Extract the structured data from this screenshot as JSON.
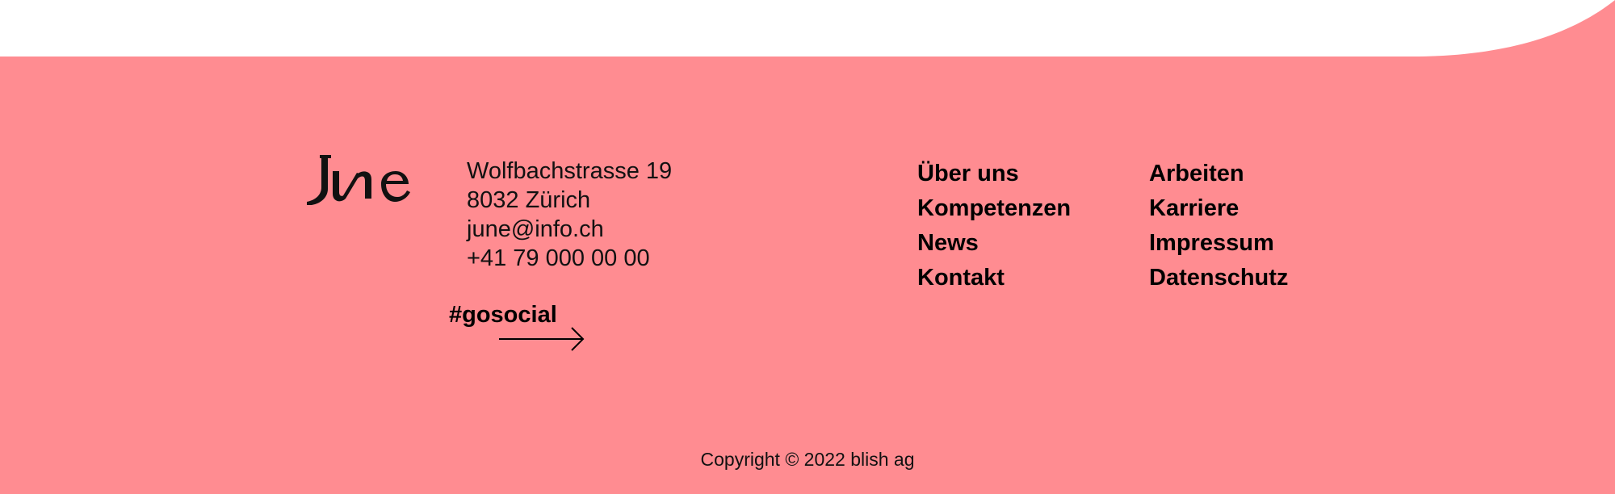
{
  "colors": {
    "footer_bg": "#ff8c91",
    "text": "#000000",
    "page_bg": "#ffffff"
  },
  "brand": {
    "logo_text": "June"
  },
  "address": {
    "street": "Wolfbachstrasse 19",
    "city": "8032 Zürich",
    "email": "june@info.ch",
    "phone": "+41 79 000 00 00"
  },
  "social": {
    "label": "#gosocial",
    "icon": "arrow-right-icon"
  },
  "nav": {
    "col1": [
      "Über uns",
      "Kompetenzen",
      "News",
      "Kontakt"
    ],
    "col2": [
      "Arbeiten",
      "Karriere",
      "Impressum",
      "Datenschutz"
    ]
  },
  "copyright": "Copyright © 2022 blish ag"
}
